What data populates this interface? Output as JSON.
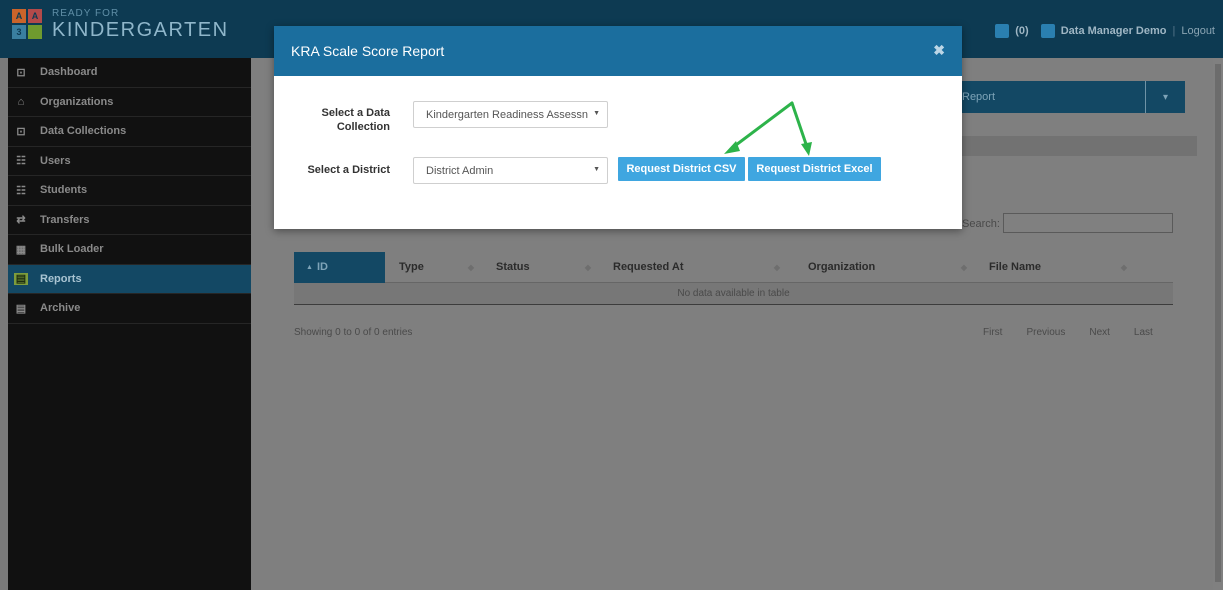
{
  "header": {
    "logo_blocks": [
      "A",
      "A",
      "3",
      ""
    ],
    "logo_small": "READY FOR",
    "logo_big": "KINDERGARTEN",
    "notif_count": "(0)",
    "user_name": "Data Manager Demo",
    "separator": "|",
    "logout": "Logout"
  },
  "sidebar": {
    "items": [
      {
        "label": "Dashboard",
        "icon": "dashboard-icon",
        "glyph": "⊡"
      },
      {
        "label": "Organizations",
        "icon": "organizations-icon",
        "glyph": "⌂"
      },
      {
        "label": "Data Collections",
        "icon": "data-collections-icon",
        "glyph": "⊡"
      },
      {
        "label": "Users",
        "icon": "users-icon",
        "glyph": "☷"
      },
      {
        "label": "Students",
        "icon": "students-icon",
        "glyph": "☷"
      },
      {
        "label": "Transfers",
        "icon": "transfers-icon",
        "glyph": "⇄"
      },
      {
        "label": "Bulk Loader",
        "icon": "bulk-loader-icon",
        "glyph": "▦"
      },
      {
        "label": "Reports",
        "icon": "reports-icon",
        "glyph": "▤",
        "active": true
      },
      {
        "label": "Archive",
        "icon": "archive-icon",
        "glyph": "▤"
      }
    ]
  },
  "main": {
    "report_select_value": "Report",
    "search_label": "Search:",
    "search_value": "",
    "table": {
      "columns": [
        "ID",
        "Type",
        "Status",
        "Requested At",
        "Organization",
        "File Name"
      ],
      "empty_message": "No data available in table"
    },
    "info": "Showing 0 to 0 of 0 entries",
    "pager": [
      "First",
      "Previous",
      "Next",
      "Last"
    ]
  },
  "modal": {
    "title": "KRA Scale Score Report",
    "close_glyph": "✖",
    "data_collection_label": "Select a Data Collection",
    "data_collection_value": "Kindergarten Readiness Assessn",
    "district_label": "Select a District",
    "district_value": "District Admin",
    "btn_csv": "Request District CSV",
    "btn_excel": "Request District Excel"
  },
  "colors": {
    "annotation_arrow": "#2db34a",
    "button": "#3fa6e0",
    "modal_header": "#1b6e9e"
  }
}
